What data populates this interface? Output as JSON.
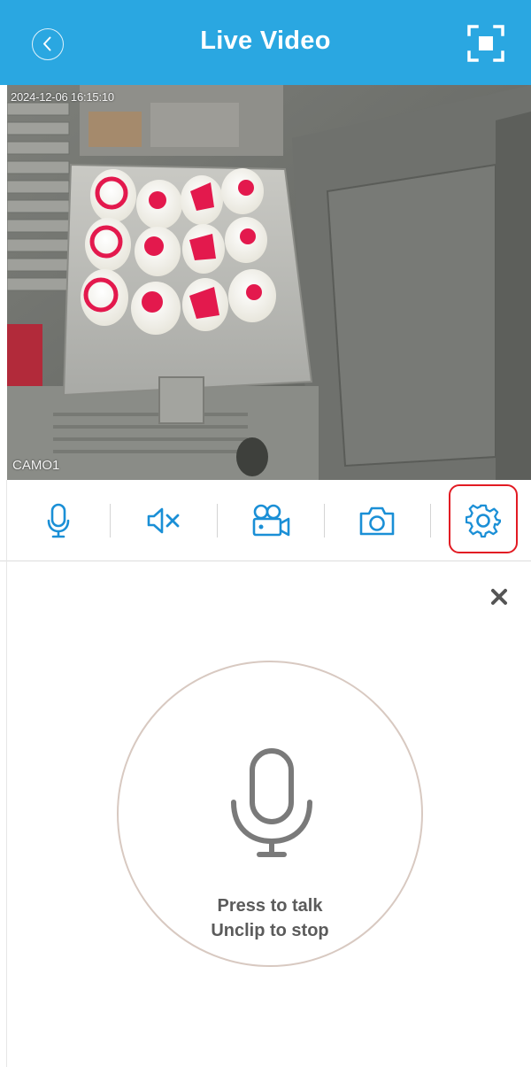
{
  "header": {
    "title": "Live Video",
    "background_color": "#2aa7e1",
    "back_icon": "chevron-left-circle-icon",
    "fullscreen_icon": "fullscreen-frame-icon"
  },
  "video": {
    "timestamp": "2024-12-06 16:15:10",
    "camera_name": "CAMO1"
  },
  "toolbar": {
    "accent_color": "#1a8fd6",
    "highlight_color": "#e21b23",
    "buttons": [
      {
        "icon": "microphone-icon"
      },
      {
        "icon": "speaker-muted-icon"
      },
      {
        "icon": "video-camera-icon"
      },
      {
        "icon": "camera-icon"
      },
      {
        "icon": "gear-icon",
        "highlighted": true
      }
    ]
  },
  "talk_panel": {
    "close_icon": "close-icon",
    "mic_icon": "microphone-icon",
    "line1": "Press to talk",
    "line2": "Unclip to stop"
  }
}
